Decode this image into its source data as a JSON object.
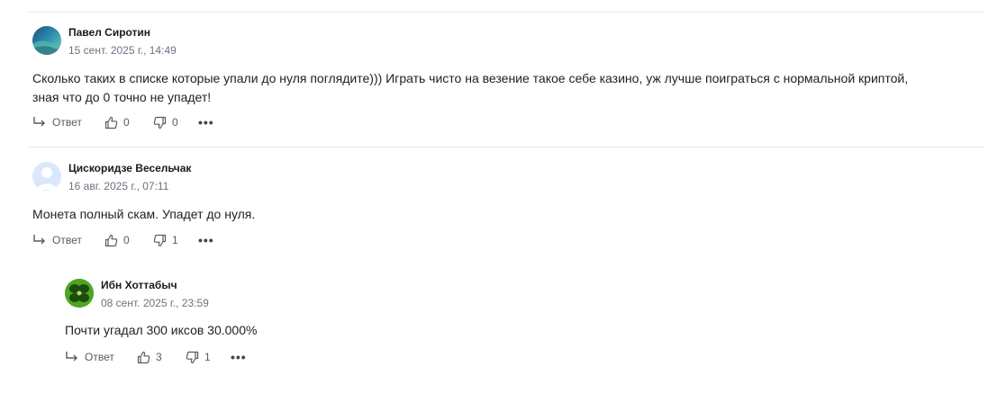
{
  "comments": [
    {
      "author": "Павел Сиротин",
      "date": "15 сент. 2025 г., 14:49",
      "text_line1": "Сколько таких в списке которые упали до нуля поглядите))) Играть чисто на везение такое себе казино, уж лучше поиграться с нормальной криптой,",
      "text_line2": "зная что до 0 точно не упадет!",
      "reply_label": "Ответ",
      "likes": "0",
      "dislikes": "0"
    },
    {
      "author": "Цискоридзе Весельчак",
      "date": "16 авг. 2025 г., 07:11",
      "text": "Монета полный скам. Упадет до нуля.",
      "reply_label": "Ответ",
      "likes": "0",
      "dislikes": "1"
    },
    {
      "author": "Ибн Хоттабыч",
      "date": "08 сент. 2025 г., 23:59",
      "text": "Почти угадал 300 иксов 30.000%",
      "reply_label": "Ответ",
      "likes": "3",
      "dislikes": "1"
    }
  ],
  "colors": {
    "text": "#1f1f1f",
    "muted": "#6b7280",
    "divider": "#e6e8eb"
  },
  "icons": {
    "reply": "reply-arrow-icon",
    "like": "thumbs-up-icon",
    "dislike": "thumbs-down-icon",
    "more": "more-dots-icon"
  }
}
